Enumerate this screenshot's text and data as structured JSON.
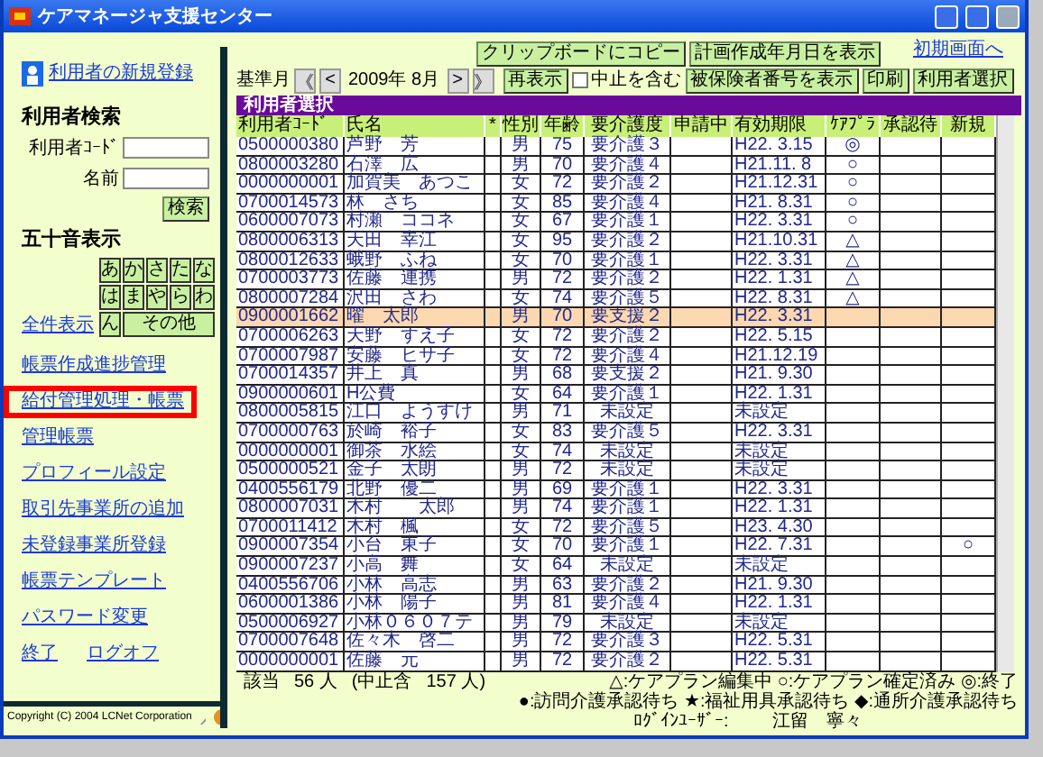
{
  "window": {
    "title": "ケアマネージャ支援センター"
  },
  "sidebar": {
    "new_user_link": "利用者の新規登録",
    "search": {
      "title": "利用者検索",
      "code_label": "利用者ｺｰﾄﾞ",
      "name_label": "名前",
      "button": "検索"
    },
    "kana": {
      "title": "五十音表示",
      "keys": [
        "あ",
        "か",
        "さ",
        "た",
        "な",
        "は",
        "ま",
        "や",
        "ら",
        "わ",
        "ん",
        "その他"
      ],
      "show_all": "全件表示"
    },
    "links": [
      {
        "label": "帳票作成進捗管理",
        "highlighted": false
      },
      {
        "label": "給付管理処理・帳票",
        "highlighted": true
      },
      {
        "label": "管理帳票",
        "highlighted": false
      },
      {
        "label": "プロフィール設定",
        "highlighted": false
      },
      {
        "label": "取引先事業所の追加",
        "highlighted": false
      },
      {
        "label": "未登録事業所登録",
        "highlighted": false
      },
      {
        "label": "帳票テンプレート",
        "highlighted": false
      },
      {
        "label": "パスワード変更",
        "highlighted": false
      }
    ],
    "exit_links": [
      "終了",
      "ログオフ"
    ],
    "copyright": "Copyright (C) 2004 LCNet Corporation"
  },
  "toolbar": {
    "clipboard_button": "クリップボードにコピー",
    "plan_date_button": "計画作成年月日を表示",
    "home_link": "初期画面へ",
    "month_label": "基準月",
    "nav": [
      "《",
      "<",
      ">",
      "》"
    ],
    "month": "2009年 8月",
    "refresh_button": "再表示",
    "include_stopped": {
      "label": "中止を含む",
      "checked": false
    },
    "insured_button": "被保険者番号を表示",
    "print_button": "印刷",
    "select_button": "利用者選択"
  },
  "table": {
    "title": "利用者選択",
    "columns": [
      "利用者ｺｰﾄﾞ",
      "氏名",
      "*",
      "性別",
      "年齢",
      "要介護度",
      "申請中",
      "有効期限",
      "ｹｱﾌﾟﾗ",
      "承認待",
      "新規"
    ],
    "rows": [
      {
        "code": "0500000380",
        "name": "芦野　芳",
        "sex": "男",
        "age": "75",
        "care": "要介護３",
        "expiry": "H22. 3.15",
        "careplan": "◎",
        "selected": false
      },
      {
        "code": "0800003280",
        "name": "石澤　広",
        "sex": "男",
        "age": "70",
        "care": "要介護４",
        "expiry": "H21.11. 8",
        "careplan": "○",
        "selected": false
      },
      {
        "code": "0000000001",
        "name": "加賀美　あつこ",
        "sex": "女",
        "age": "72",
        "care": "要介護２",
        "expiry": "H21.12.31",
        "careplan": "○",
        "selected": false
      },
      {
        "code": "0700014573",
        "name": "林　さち",
        "sex": "女",
        "age": "85",
        "care": "要介護４",
        "expiry": "H21. 8.31",
        "careplan": "○",
        "selected": false
      },
      {
        "code": "0600007073",
        "name": "村瀬　ココネ",
        "sex": "女",
        "age": "67",
        "care": "要介護１",
        "expiry": "H22. 3.31",
        "careplan": "○",
        "selected": false
      },
      {
        "code": "0800006313",
        "name": "天田　幸江",
        "sex": "女",
        "age": "95",
        "care": "要介護２",
        "expiry": "H21.10.31",
        "careplan": "△",
        "selected": false
      },
      {
        "code": "0800012633",
        "name": "蛾野　ふね",
        "sex": "女",
        "age": "70",
        "care": "要介護１",
        "expiry": "H22. 3.31",
        "careplan": "△",
        "selected": false
      },
      {
        "code": "0700003773",
        "name": "佐藤　連携",
        "sex": "男",
        "age": "72",
        "care": "要介護２",
        "expiry": "H22. 1.31",
        "careplan": "△",
        "selected": false
      },
      {
        "code": "0800007284",
        "name": "沢田　さわ",
        "sex": "女",
        "age": "74",
        "care": "要介護５",
        "expiry": "H22. 8.31",
        "careplan": "△",
        "selected": false
      },
      {
        "code": "0900001662",
        "name": "曜　太郎",
        "sex": "男",
        "age": "70",
        "care": "要支援２",
        "expiry": "H22. 3.31",
        "selected": true
      },
      {
        "code": "0700006263",
        "name": "天野　すえ子",
        "sex": "女",
        "age": "72",
        "care": "要介護２",
        "expiry": "H22. 5.15",
        "selected": false
      },
      {
        "code": "0700007987",
        "name": "安藤　ヒサ子",
        "sex": "女",
        "age": "72",
        "care": "要介護４",
        "expiry": "H21.12.19",
        "selected": false
      },
      {
        "code": "0700014357",
        "name": "井上　真",
        "sex": "男",
        "age": "68",
        "care": "要支援２",
        "expiry": "H21. 9.30",
        "selected": false
      },
      {
        "code": "0900000601",
        "name": "H公費",
        "sex": "女",
        "age": "64",
        "care": "要介護１",
        "expiry": "H22. 1.31",
        "selected": false
      },
      {
        "code": "0800005815",
        "name": "江口　ようすけ",
        "sex": "男",
        "age": "71",
        "care": "未設定",
        "expiry": "未設定",
        "selected": false
      },
      {
        "code": "0700000763",
        "name": "於崎　裕子",
        "sex": "女",
        "age": "83",
        "care": "要介護５",
        "expiry": "H22. 3.31",
        "selected": false
      },
      {
        "code": "0000000001",
        "name": "御茶　水絵",
        "sex": "女",
        "age": "74",
        "care": "未設定",
        "expiry": "未設定",
        "selected": false
      },
      {
        "code": "0500000521",
        "name": "金子　太朗",
        "sex": "男",
        "age": "72",
        "care": "未設定",
        "expiry": "未設定",
        "selected": false
      },
      {
        "code": "0400556179",
        "name": "北野　優二",
        "sex": "男",
        "age": "69",
        "care": "要介護１",
        "expiry": "H22. 3.31",
        "selected": false
      },
      {
        "code": "0800007031",
        "name": "木村　　太郎",
        "sex": "男",
        "age": "74",
        "care": "要介護１",
        "expiry": "H22. 1.31",
        "selected": false
      },
      {
        "code": "0700011412",
        "name": "木村　楓",
        "sex": "女",
        "age": "72",
        "care": "要介護５",
        "expiry": "H23. 4.30",
        "selected": false
      },
      {
        "code": "0900007354",
        "name": "小台　東子",
        "sex": "女",
        "age": "70",
        "care": "要介護１",
        "expiry": "H22. 7.31",
        "new": "○",
        "selected": false
      },
      {
        "code": "0900007237",
        "name": "小高　舞",
        "sex": "女",
        "age": "64",
        "care": "未設定",
        "expiry": "未設定",
        "selected": false
      },
      {
        "code": "0400556706",
        "name": "小林　高志",
        "sex": "男",
        "age": "63",
        "care": "要介護２",
        "expiry": "H21. 9.30",
        "selected": false
      },
      {
        "code": "0600001386",
        "name": "小林　陽子",
        "sex": "男",
        "age": "81",
        "care": "要介護４",
        "expiry": "H22. 1.31",
        "selected": false
      },
      {
        "code": "0500006927",
        "name": "小林０６０７テ",
        "sex": "男",
        "age": "79",
        "care": "未設定",
        "expiry": "未設定",
        "selected": false
      },
      {
        "code": "0700007648",
        "name": "佐々木　啓二",
        "sex": "男",
        "age": "72",
        "care": "要介護３",
        "expiry": "H22. 5.31",
        "selected": false
      },
      {
        "code": "0000000001",
        "name": "佐藤　元",
        "sex": "男",
        "age": "72",
        "care": "要介護２",
        "expiry": "H22. 5.31",
        "selected": false
      }
    ]
  },
  "footer": {
    "count_label": "該当",
    "count": "56 人",
    "stopped_label": "(中止含",
    "stopped_count": "157 人)",
    "legend": [
      "△:ケアプラン編集中 ○:ケアプラン確定済み ◎:終了",
      "●:訪問介護承認待ち ★:福祉用具承認待ち ◆:通所介護承認待ち"
    ],
    "login_label": "ﾛｸﾞｲﾝﾕｰｻﾞｰ:",
    "login_user": "江留　寧々"
  }
}
